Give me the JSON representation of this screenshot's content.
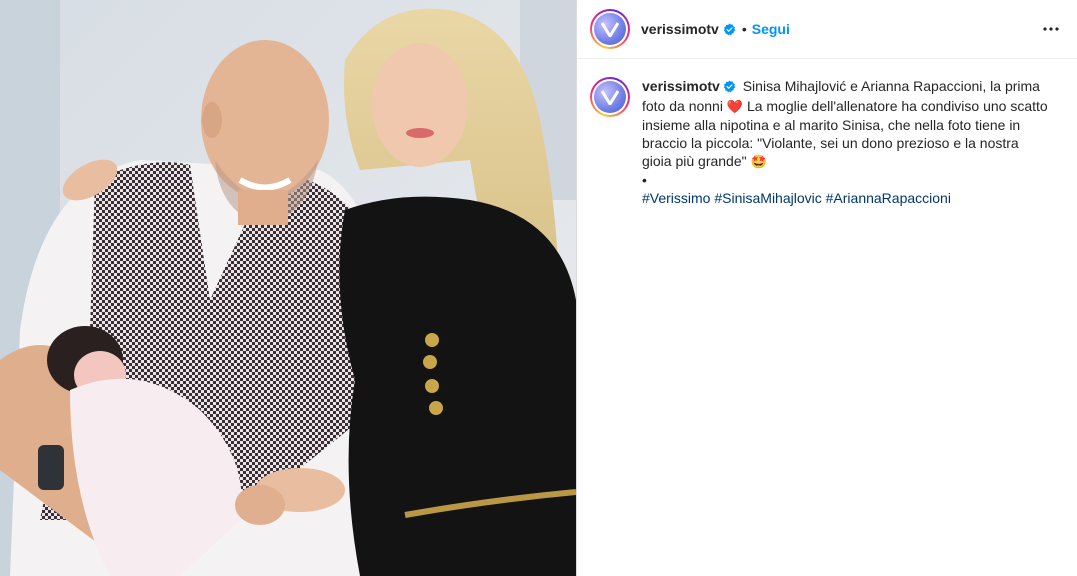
{
  "post": {
    "username": "verissimotv",
    "follow_label": "Segui",
    "separator": "•",
    "caption": {
      "username": "verissimotv",
      "text_part1": "Sinisa Mihajlović e Arianna Rapaccioni, la prima foto da nonni",
      "text_part2": "La moglie dell'allenatore ha condiviso uno scatto insieme alla nipotina e al marito Sinisa, che nella foto tiene in braccio la piccola: \"Violante, sei un dono prezioso e la nostra gioia più grande\"",
      "heart_emoji": "❤️",
      "star_eyes_emoji": "🤩",
      "bullet": "•",
      "hashtags": [
        "#Verissimo",
        "#SinisaMihajlovic",
        "#AriannaRapaccioni"
      ]
    }
  },
  "icons": {
    "verified": "verified-badge-icon",
    "more": "more-options-icon",
    "avatar": "verissimo-logo-icon"
  },
  "colors": {
    "follow": "#0095f6",
    "verified": "#0095f6",
    "hashtag": "#00376b",
    "text": "#262626"
  }
}
